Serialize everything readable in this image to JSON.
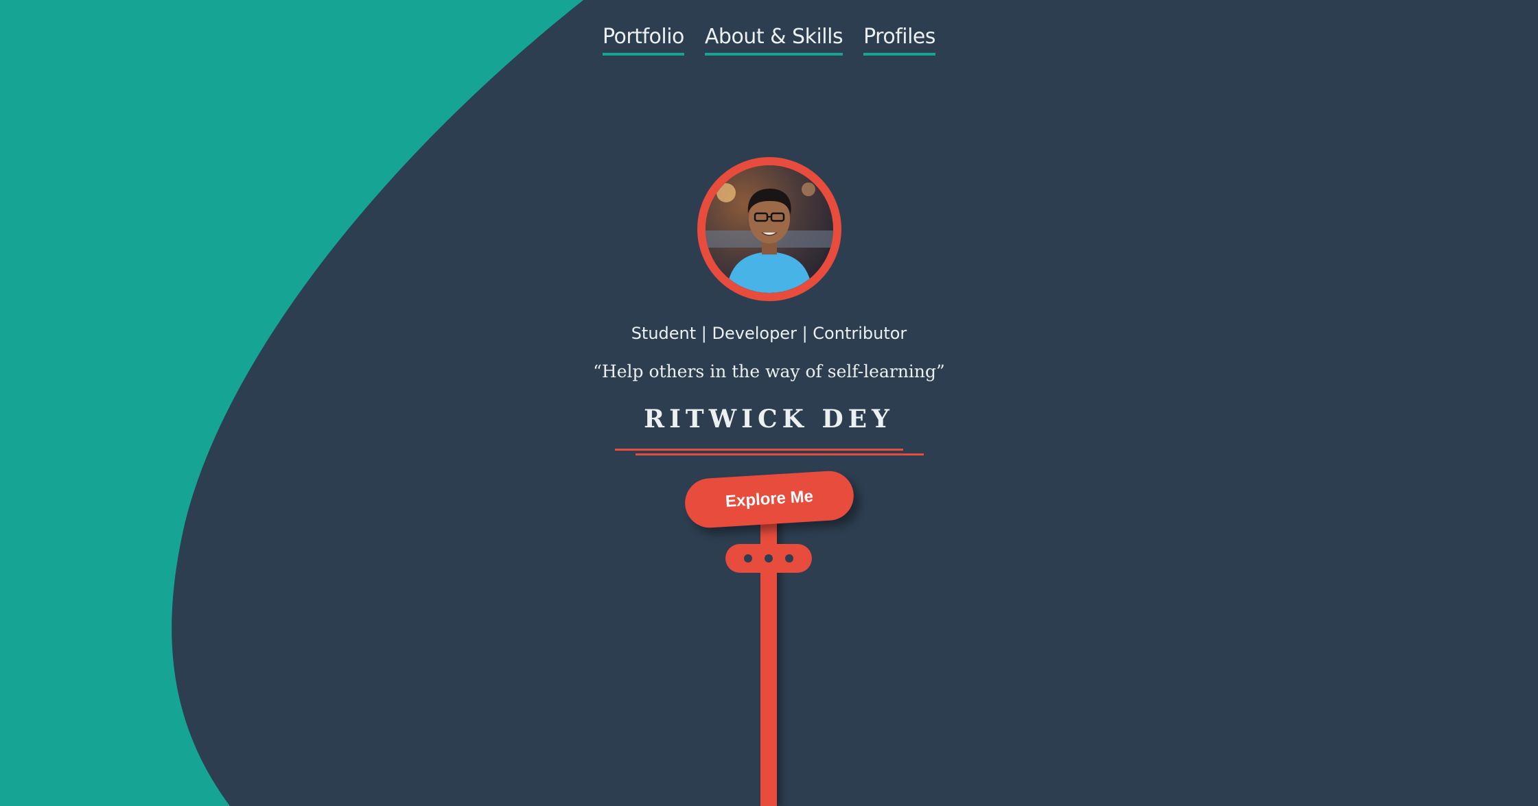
{
  "nav": {
    "items": [
      {
        "label": "Portfolio"
      },
      {
        "label": "About & Skills"
      },
      {
        "label": "Profiles"
      }
    ]
  },
  "hero": {
    "roles": "Student | Developer | Contributor",
    "quote": "“Help others in the way of self-learning”",
    "name": "RITWICK DEY",
    "cta_label": "Explore Me"
  },
  "colors": {
    "background": "#2d3e50",
    "accent_teal": "#16a595",
    "accent_red": "#e74c3c",
    "text": "#ecf0f1"
  },
  "icons": {
    "avatar": "profile-photo",
    "more": "three-dots"
  }
}
